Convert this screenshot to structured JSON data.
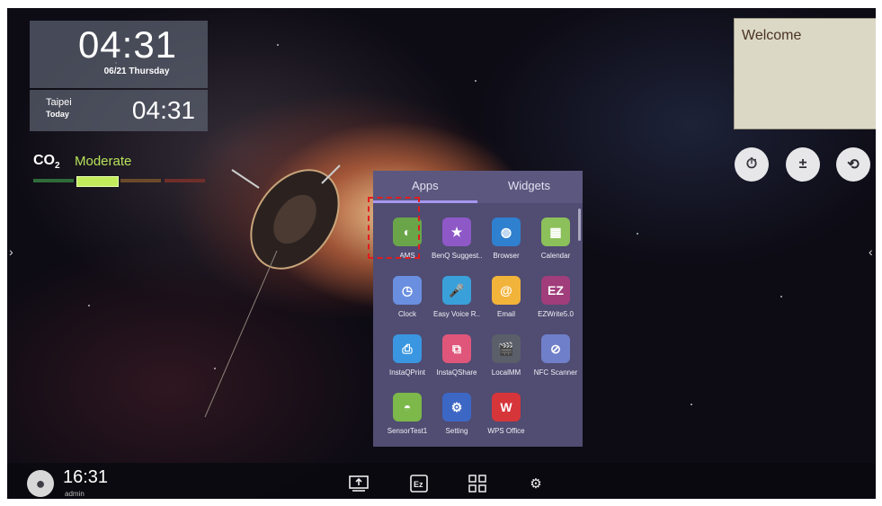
{
  "clock": {
    "time": "04:31",
    "date": "06/21 Thursday"
  },
  "world_clock": {
    "city": "Taipei",
    "day": "Today",
    "time": "04:31"
  },
  "co2": {
    "label": "CO",
    "subscript": "2",
    "level": "Moderate"
  },
  "note": {
    "text": "Welcome"
  },
  "side_buttons": [
    "timer-icon",
    "calculator-icon",
    "restore-icon"
  ],
  "drawer": {
    "tabs": [
      "Apps",
      "Widgets"
    ],
    "active_tab": "Apps",
    "apps": [
      {
        "label": "AMS",
        "icon": "ams-icon",
        "color": "#6aa54a",
        "glyph": "◐"
      },
      {
        "label": "BenQ Suggest..",
        "icon": "benq-suggest-icon",
        "color": "#8e58c7",
        "glyph": "★"
      },
      {
        "label": "Browser",
        "icon": "browser-globe-icon",
        "color": "#2f80cf",
        "glyph": "◍"
      },
      {
        "label": "Calendar",
        "icon": "calendar-icon",
        "color": "#8cc05a",
        "glyph": "▦"
      },
      {
        "label": "Clock",
        "icon": "clock-icon",
        "color": "#6a8fe0",
        "glyph": "◷"
      },
      {
        "label": "Easy Voice R..",
        "icon": "microphone-icon",
        "color": "#3aa0d9",
        "glyph": "🎤"
      },
      {
        "label": "Email",
        "icon": "email-icon",
        "color": "#f2b33a",
        "glyph": "@"
      },
      {
        "label": "EZWrite5.0",
        "icon": "ezwrite-icon",
        "color": "#a03d7a",
        "glyph": "EZ"
      },
      {
        "label": "InstaQPrint",
        "icon": "printer-icon",
        "color": "#3a96e0",
        "glyph": "⎙"
      },
      {
        "label": "InstaQShare",
        "icon": "share-icon",
        "color": "#e0567a",
        "glyph": "⧉"
      },
      {
        "label": "LocalMM",
        "icon": "film-clapper-icon",
        "color": "#5a5f6a",
        "glyph": "🎬"
      },
      {
        "label": "NFC Scanner",
        "icon": "nfc-tag-icon",
        "color": "#6f7fc9",
        "glyph": "⊘"
      },
      {
        "label": "SensorTest1",
        "icon": "android-icon",
        "color": "#7cb84a",
        "glyph": "◓"
      },
      {
        "label": "Setting",
        "icon": "gear-icon",
        "color": "#3c67c4",
        "glyph": "⚙"
      },
      {
        "label": "WPS Office",
        "icon": "wps-icon",
        "color": "#d6353a",
        "glyph": "W"
      }
    ]
  },
  "taskbar": {
    "time": "16:31",
    "user": "admin",
    "icons": [
      "screen-share-icon",
      "ezwrite-icon",
      "apps-grid-icon",
      "settings-gear-icon"
    ]
  }
}
